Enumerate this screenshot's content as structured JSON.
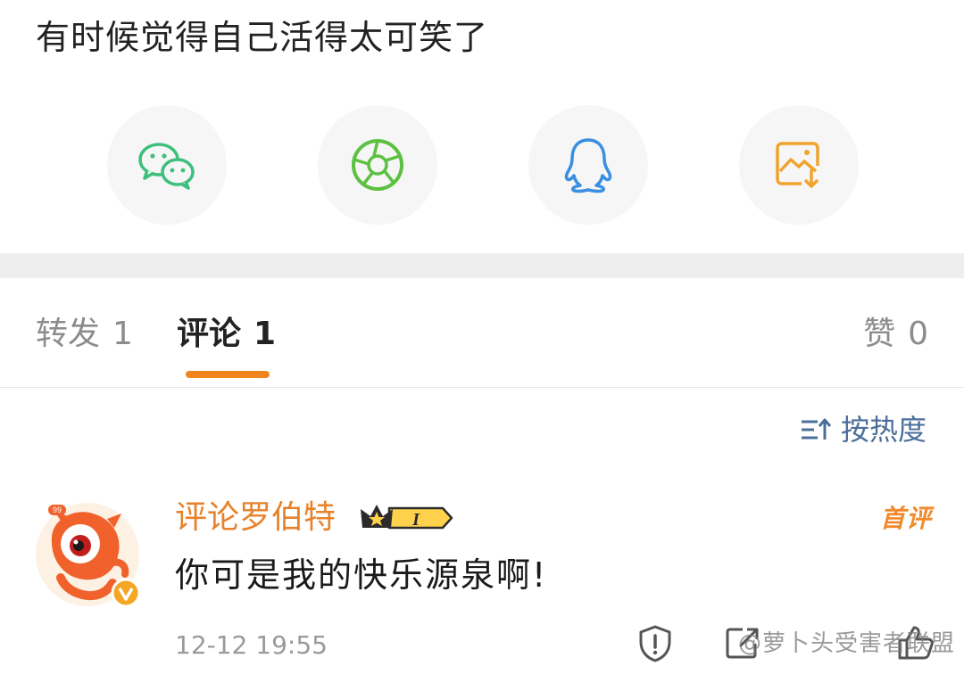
{
  "post": {
    "text": "有时候觉得自己活得太可笑了"
  },
  "share": {
    "items": [
      {
        "icon": "wechat-icon",
        "color": "#3fbf7c"
      },
      {
        "icon": "moments-icon",
        "color": "#5cc040"
      },
      {
        "icon": "qq-icon",
        "color": "#3a8fe0"
      },
      {
        "icon": "save-image-icon",
        "color": "#f0a32c"
      }
    ]
  },
  "tabs": [
    {
      "label": "转发",
      "count": "1",
      "active": false
    },
    {
      "label": "评论",
      "count": "1",
      "active": true
    },
    {
      "label": "赞",
      "count": "0",
      "active": false
    }
  ],
  "sort": {
    "label": "按热度"
  },
  "comment": {
    "username": "评论罗伯特",
    "avatar_badge": "99",
    "level_badge": "I",
    "first_tag": "首评",
    "text": "你可是我的快乐源泉啊!",
    "timestamp": "12-12 19:55"
  },
  "watermark": {
    "text": "@萝卜头受害者联盟"
  },
  "colors": {
    "accent_orange": "#f0841f",
    "username": "#e8822a",
    "sort_blue": "#4b6e9b",
    "tab_inactive": "#8c8c8c"
  }
}
